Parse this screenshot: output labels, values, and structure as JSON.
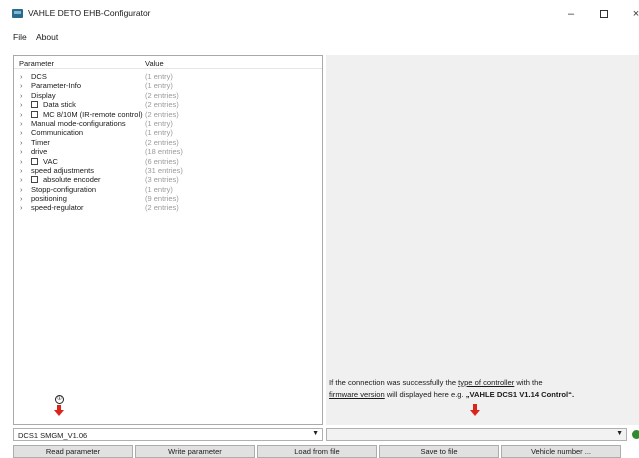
{
  "window": {
    "title": "VAHLE DETO EHB-Configurator",
    "minimize": "–",
    "close": "×"
  },
  "menu": {
    "file": "File",
    "about": "About"
  },
  "tree": {
    "header_parameter": "Parameter",
    "header_value": "Value",
    "rows": [
      {
        "label": "DCS",
        "value": "(1 entry)",
        "checkbox": false
      },
      {
        "label": "Parameter-Info",
        "value": "(1 entry)",
        "checkbox": false
      },
      {
        "label": "Display",
        "value": "(2 entries)",
        "checkbox": false
      },
      {
        "label": "Data stick",
        "value": "(2 entries)",
        "checkbox": true
      },
      {
        "label": "MC 8/10M (IR-remote control)",
        "value": "(2 entries)",
        "checkbox": true
      },
      {
        "label": "Manual mode-configurations",
        "value": "(1 entry)",
        "checkbox": false
      },
      {
        "label": "Communication",
        "value": "(1 entry)",
        "checkbox": false
      },
      {
        "label": "Timer",
        "value": "(2 entries)",
        "checkbox": false
      },
      {
        "label": "drive",
        "value": "(18 entries)",
        "checkbox": false
      },
      {
        "label": "VAC",
        "value": "(6 entries)",
        "checkbox": true
      },
      {
        "label": "speed adjustments",
        "value": "(31 entries)",
        "checkbox": false
      },
      {
        "label": "absolute encoder",
        "value": "(3 entries)",
        "checkbox": true
      },
      {
        "label": "Stopp-configuration",
        "value": "(1 entry)",
        "checkbox": false
      },
      {
        "label": "positioning",
        "value": "(9 entries)",
        "checkbox": false
      },
      {
        "label": "speed-regulator",
        "value": "(2 entries)",
        "checkbox": false
      }
    ]
  },
  "info": {
    "part1": "If the connection was successfully the ",
    "link1": "type of controller",
    "part2": " with the",
    "link2": "firmware version",
    "part3": " will displayed here e.g. ",
    "bold": "„VAHLE DCS1 V1.14 Control“."
  },
  "annotation": {
    "marker": "①"
  },
  "controller_select": {
    "value": "DCS1 SMGM_V1.06"
  },
  "firmware_select": {
    "value": ""
  },
  "buttons": {
    "read": "Read parameter",
    "write": "Write parameter",
    "load": "Load from file",
    "save": "Save to file",
    "vehicle": "Vehicle number ..."
  },
  "colors": {
    "arrow": "#d9251c",
    "status_ok": "#2e8b2e"
  }
}
